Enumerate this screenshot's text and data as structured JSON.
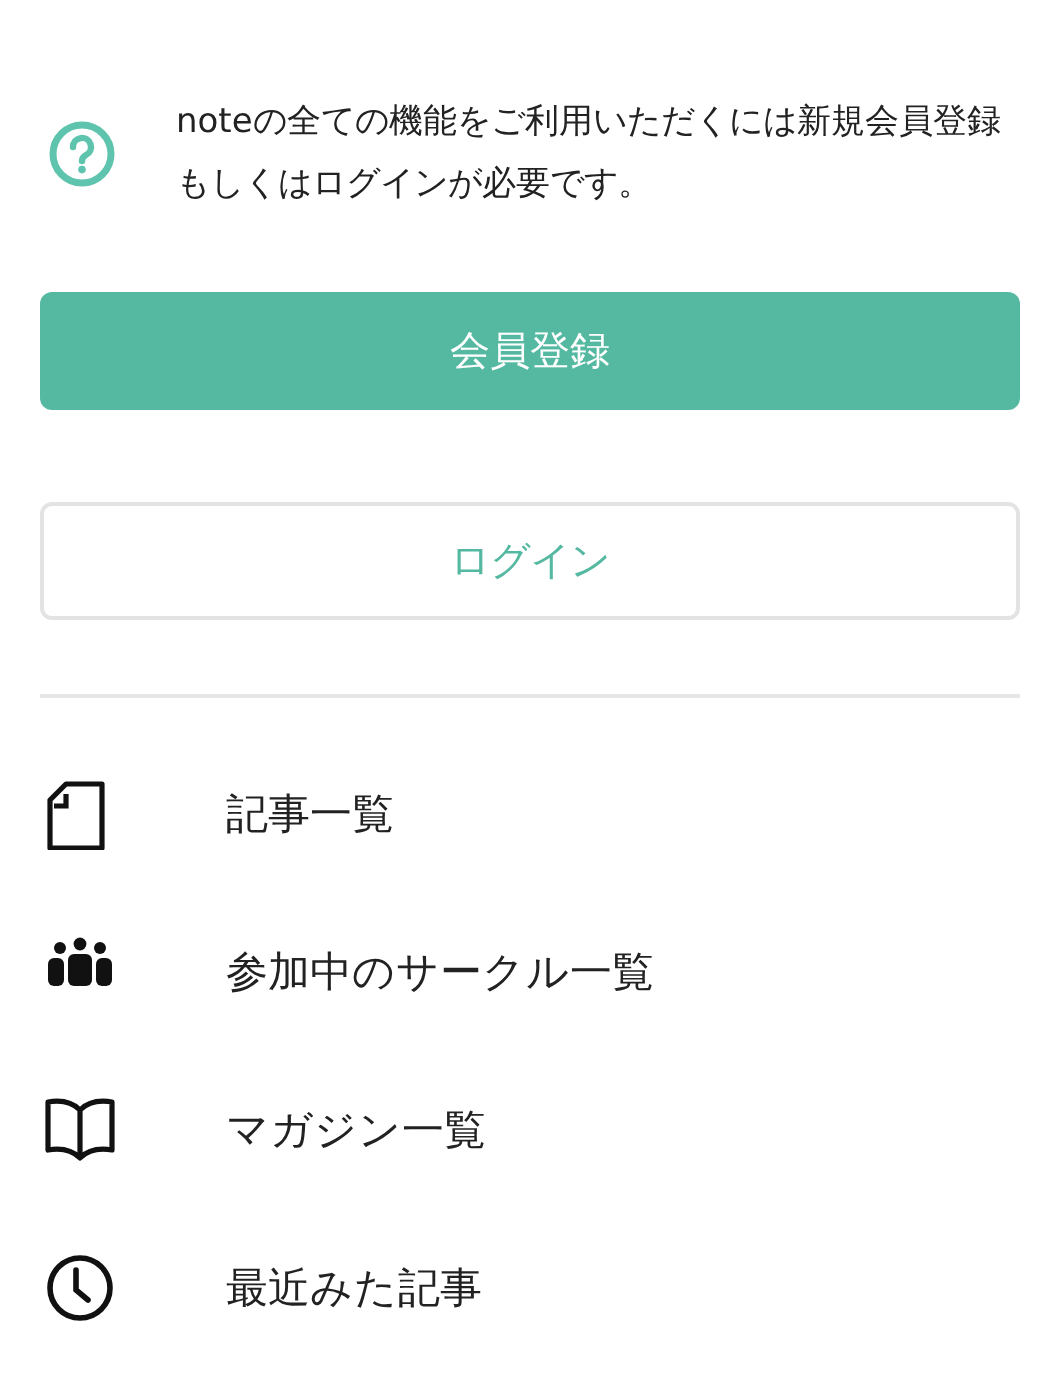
{
  "notice": {
    "text": "noteの全ての機能をご利用いただくには新規会員登録もしくはログインが必要です。"
  },
  "buttons": [
    {
      "kind": "primary",
      "label": "会員登録"
    },
    {
      "kind": "secondary",
      "label": "ログイン"
    }
  ],
  "menu": [
    {
      "kind": "article",
      "label": "記事一覧"
    },
    {
      "kind": "circle",
      "label": "参加中のサークル一覧"
    },
    {
      "kind": "magazine",
      "label": "マガジン一覧"
    },
    {
      "kind": "recent",
      "label": "最近みた記事"
    }
  ]
}
